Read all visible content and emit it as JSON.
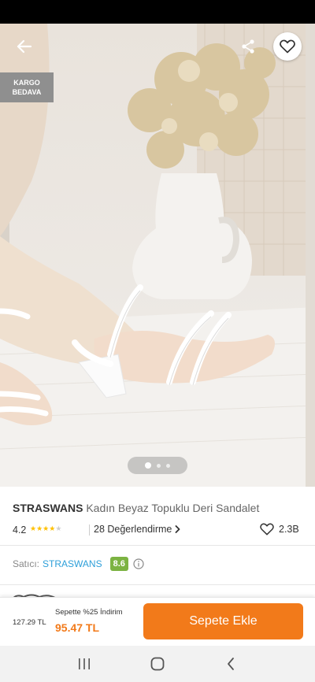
{
  "gallery": {
    "cargo_badge": {
      "line1": "KARGO",
      "line2": "BEDAVA"
    },
    "image_count": 3,
    "active_image": 1,
    "icons": {
      "back": "arrow-left-icon",
      "share": "share-icon",
      "favorite": "heart-outline-icon"
    }
  },
  "product": {
    "brand": "STRASWANS",
    "name": "Kadın Beyaz Topuklu Deri Sandalet",
    "rating": "4.2",
    "rating_value": 4.2,
    "rating_max": 5,
    "reviews_label": "28 Değerlendirme",
    "favorites_count": "2.3B"
  },
  "seller": {
    "label": "Satıcı:",
    "name": "STRASWANS",
    "score": "8.6"
  },
  "purchase": {
    "old_price": "127.29 TL",
    "promo_text": "Sepette %25 İndirim",
    "new_price": "95.47 TL",
    "add_to_cart_label": "Sepete Ekle"
  },
  "colors": {
    "brand_orange": "#f27a1a",
    "star_yellow": "#ffc000",
    "seller_link": "#2d9fd9",
    "seller_score_green": "#7cb342"
  },
  "navigation": {
    "buttons": [
      "recent-apps-icon",
      "home-icon",
      "back-icon"
    ]
  }
}
